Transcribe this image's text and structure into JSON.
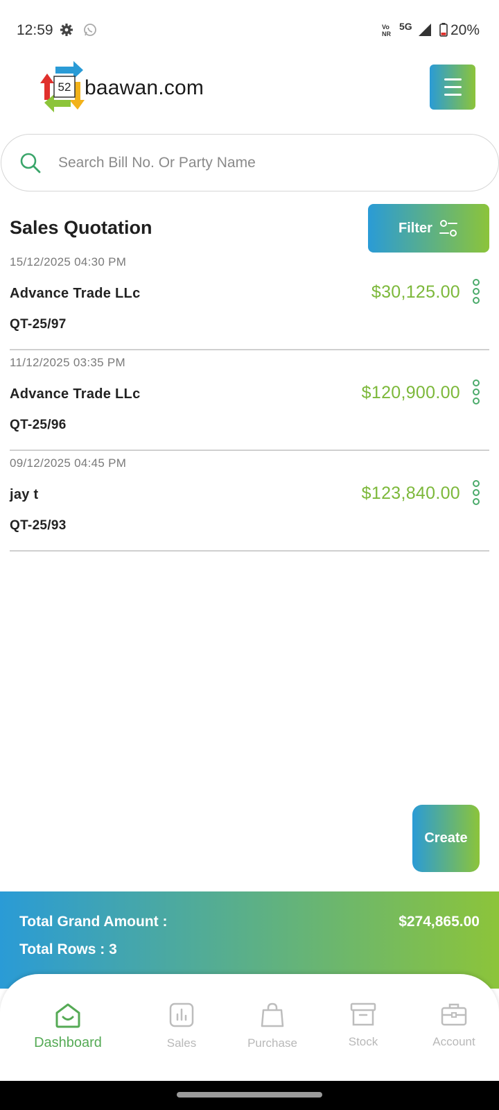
{
  "status_bar": {
    "time": "12:59",
    "volte_top": "Vo",
    "volte_bottom": "NR",
    "network": "5G",
    "battery": "20%"
  },
  "header": {
    "logo_number": "52",
    "brand": "baawan.com"
  },
  "search": {
    "placeholder": "Search Bill No. Or Party Name",
    "value": ""
  },
  "page": {
    "title": "Sales Quotation",
    "filter_label": "Filter",
    "create_label": "Create"
  },
  "quotations": [
    {
      "date": "15/12/2025 04:30 PM",
      "party": "Advance Trade LLc",
      "bill": "QT-25/97",
      "amount": "$30,125.00"
    },
    {
      "date": "11/12/2025 03:35 PM",
      "party": "Advance Trade LLc",
      "bill": "QT-25/96",
      "amount": "$120,900.00"
    },
    {
      "date": "09/12/2025 04:45 PM",
      "party": "jay t",
      "bill": "QT-25/93",
      "amount": "$123,840.00"
    }
  ],
  "totals": {
    "grand_label": "Total Grand Amount :",
    "grand_value": "$274,865.00",
    "rows_label": "Total Rows : 3"
  },
  "nav": {
    "items": [
      {
        "label": "Dashboard",
        "icon": "home-icon",
        "active": true
      },
      {
        "label": "Sales",
        "icon": "chart-icon",
        "active": false
      },
      {
        "label": "Purchase",
        "icon": "bag-icon",
        "active": false
      },
      {
        "label": "Stock",
        "icon": "archive-icon",
        "active": false
      },
      {
        "label": "Account",
        "icon": "briefcase-icon",
        "active": false
      }
    ]
  },
  "colors": {
    "gradient_start": "#2a9bd6",
    "gradient_end": "#8cc43a",
    "amount_green": "#7cb83a",
    "active_nav": "#55aa55"
  }
}
